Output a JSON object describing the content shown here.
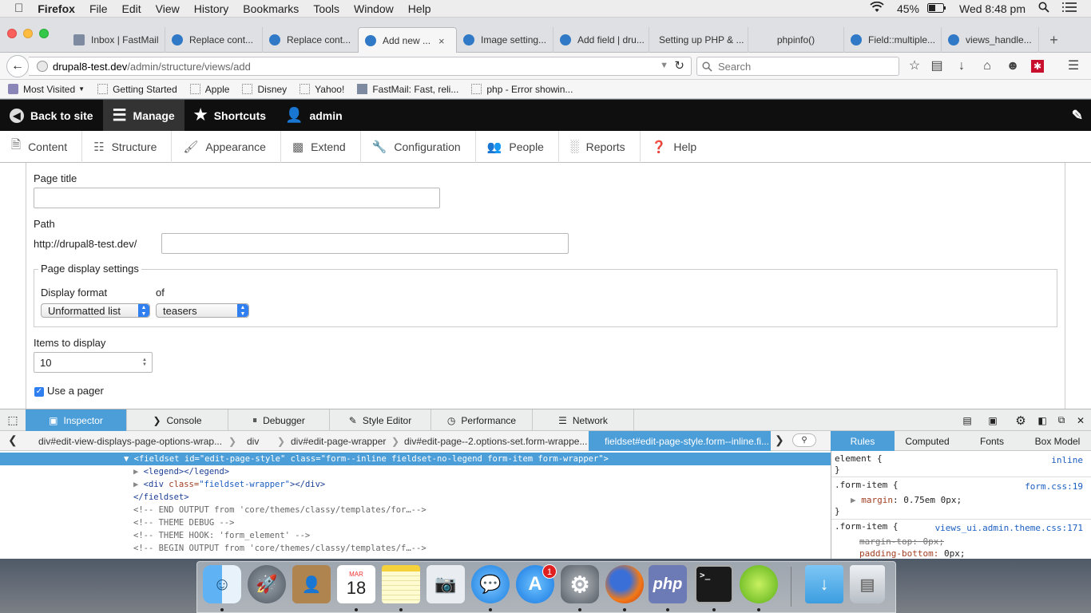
{
  "menubar": {
    "app": "Firefox",
    "items": [
      "File",
      "Edit",
      "View",
      "History",
      "Bookmarks",
      "Tools",
      "Window",
      "Help"
    ],
    "battery": "45%",
    "clock": "Wed 8:48 pm"
  },
  "tabs": [
    {
      "label": "Inbox | FastMail",
      "icon": "fastmail-favicon"
    },
    {
      "label": "Replace cont...",
      "icon": "drupal-favicon"
    },
    {
      "label": "Replace cont...",
      "icon": "drupal-favicon"
    },
    {
      "label": "Add new ...",
      "icon": "drupal-favicon",
      "active": true,
      "close": "×"
    },
    {
      "label": "Image setting...",
      "icon": "drupal-favicon"
    },
    {
      "label": "Add field | dru...",
      "icon": "drupal-favicon"
    },
    {
      "label": "Setting up PHP & ...",
      "icon": "none"
    },
    {
      "label": "phpinfo()",
      "icon": "none"
    },
    {
      "label": "Field::multiple...",
      "icon": "drupal-favicon"
    },
    {
      "label": "views_handle...",
      "icon": "drupal-favicon"
    }
  ],
  "newtab": "+",
  "url": {
    "host": "drupal8-test.dev",
    "path": "/admin/structure/views/add"
  },
  "search": {
    "placeholder": "Search"
  },
  "bookmarks": [
    "Most Visited",
    "Getting Started",
    "Apple",
    "Disney",
    "Yahoo!",
    "FastMail: Fast, reli...",
    "php - Error showin..."
  ],
  "drupal_toolbar": {
    "back": "Back to site",
    "manage": "Manage",
    "shortcuts": "Shortcuts",
    "user": "admin"
  },
  "tray": [
    "Content",
    "Structure",
    "Appearance",
    "Extend",
    "Configuration",
    "People",
    "Reports",
    "Help"
  ],
  "form": {
    "page_title_label": "Page title",
    "page_title_value": "",
    "path_label": "Path",
    "path_prefix": "http://drupal8-test.dev/",
    "path_value": "",
    "fieldset_legend": "Page display settings",
    "display_format_label": "Display format",
    "display_format_value": "Unformatted list",
    "of_label": "of",
    "of_value": "teasers",
    "items_label": "Items to display",
    "items_value": "10",
    "pager_label": "Use a pager",
    "pager_checked": true
  },
  "devtools": {
    "tabs": [
      "Inspector",
      "Console",
      "Debugger",
      "Style Editor",
      "Performance",
      "Network"
    ],
    "breadcrumbs": [
      "div#edit-view-displays-page-options-wrap...",
      "div",
      "div#edit-page-wrapper",
      "div#edit-page--2.options-set.form-wrappe...",
      "fieldset#edit-page-style.form--inline.fi..."
    ],
    "markup": {
      "sel_tag": "fieldset",
      "sel_id_val": "\"edit-page-style\"",
      "sel_class_val": "\"form--inline fieldset-no-legend form-item form-wrapper\"",
      "legend": "<legend></legend>",
      "div_class_val": "\"fieldset-wrapper\"",
      "fieldset_close": "</fieldset>",
      "c1": "<!-- END OUTPUT from 'core/themes/classy/templates/for…-->",
      "c2": "<!-- THEME DEBUG -->",
      "c3": "<!-- THEME HOOK: 'form_element' -->",
      "c4": "<!-- BEGIN OUTPUT from 'core/themes/classy/templates/f…-->"
    },
    "rule_tabs": [
      "Rules",
      "Computed",
      "Fonts",
      "Box Model"
    ],
    "rules": {
      "r1_sel": "element {",
      "r1_src": "inline",
      "r1_close": "}",
      "r2_sel": ".form-item {",
      "r2_src": "form.css:19",
      "r2_prop": "margin",
      "r2_val": "0.75em 0px;",
      "r2_close": "}",
      "r3_sel": ".form-item {",
      "r3_src": "views_ui.admin.theme.css:171",
      "r3_prop1": "margin-top: 0px;",
      "r3_prop2": "padding-bottom:",
      "r3_val2": "0px;"
    }
  },
  "dock": {
    "calendar_month": "MAR",
    "calendar_day": "18",
    "appstore_badge": "1",
    "php_label": "php"
  },
  "colors": {
    "accent": "#4c9ed9",
    "toolbar_bg": "#0f0f0f",
    "select_arrow": "#2f7ff0"
  }
}
